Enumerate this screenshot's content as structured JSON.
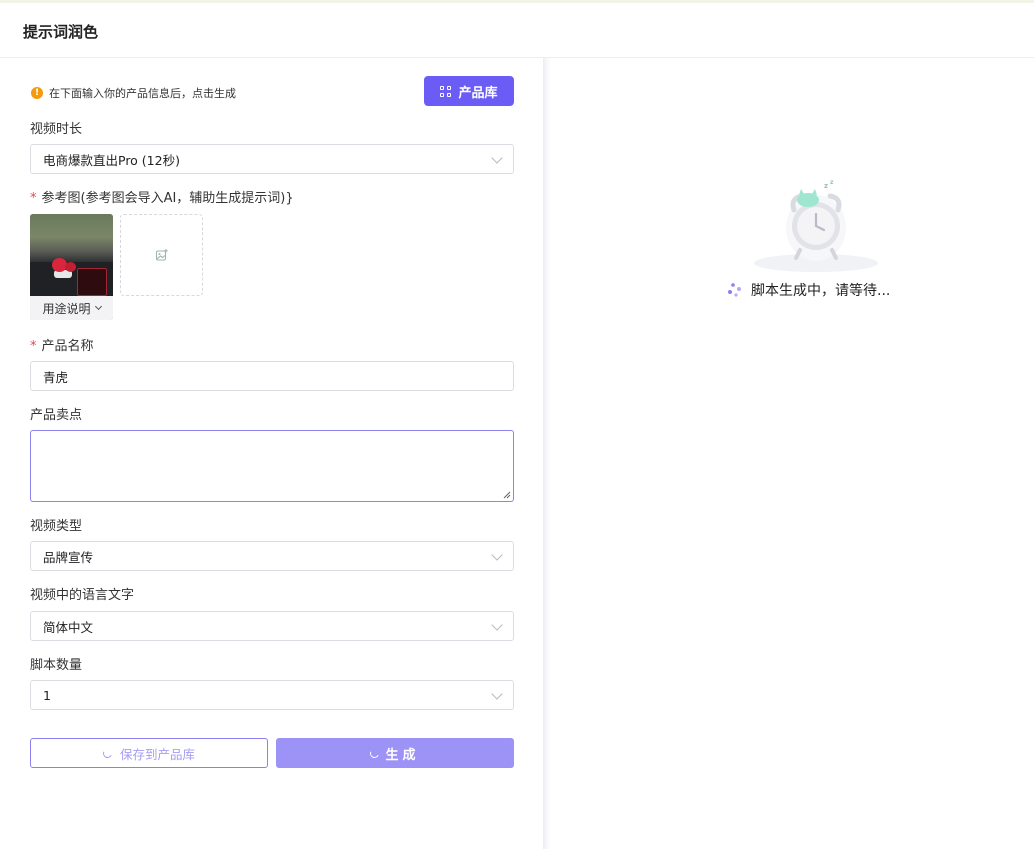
{
  "header": {
    "title": "提示词润色"
  },
  "form": {
    "hint": "在下面输入你的产品信息后，点击生成",
    "library_button": "产品库",
    "duration": {
      "label": "视频时长",
      "value": "电商爆款直出Pro (12秒)"
    },
    "reference": {
      "label": "参考图(参考图会导入AI，辅助生成提示词)}",
      "usage_label": "用途说明"
    },
    "product_name": {
      "label": "产品名称",
      "value": "青虎"
    },
    "selling_points": {
      "label": "产品卖点",
      "value": ""
    },
    "video_type": {
      "label": "视频类型",
      "value": "品牌宣传"
    },
    "language": {
      "label": "视频中的语言文字",
      "value": "简体中文"
    },
    "script_count": {
      "label": "脚本数量",
      "value": "1"
    },
    "save_button": "保存到产品库",
    "generate_button": "生成"
  },
  "preview": {
    "status": "脚本生成中，请等待..."
  },
  "colors": {
    "primary": "#6b5cf6",
    "primary_light": "#9d92f6",
    "warning": "#f59a0c",
    "required": "#e5484d"
  },
  "icons": [
    "info-icon",
    "grid-icon",
    "chevron-down-icon",
    "image-upload-icon",
    "loading-spinner-icon",
    "sleeping-clock-icon",
    "dots-loading-icon"
  ]
}
